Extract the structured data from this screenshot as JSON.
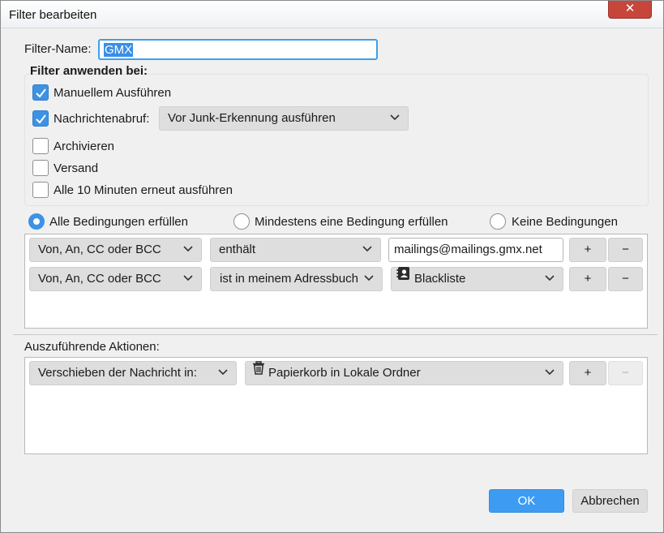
{
  "window": {
    "title": "Filter bearbeiten",
    "close_label": "✕"
  },
  "filter_name": {
    "label": "Filter-Name:",
    "value": "GMX"
  },
  "apply_section": {
    "legend": "Filter anwenden bei:",
    "options": [
      {
        "label": "Manuellem Ausführen",
        "checked": true
      },
      {
        "label": "Nachrichtenabruf:",
        "checked": true
      },
      {
        "label": "Archivieren",
        "checked": false
      },
      {
        "label": "Versand",
        "checked": false
      },
      {
        "label": "Alle 10 Minuten erneut ausführen",
        "checked": false
      }
    ],
    "fetch_timing": "Vor Junk-Erkennung ausführen"
  },
  "match_mode": {
    "options": [
      "Alle Bedingungen erfüllen",
      "Mindestens eine Bedingung erfüllen",
      "Keine Bedingungen"
    ],
    "selected": "Alle Bedingungen erfüllen"
  },
  "conditions": [
    {
      "field": "Von, An, CC oder BCC",
      "operator": "enthält",
      "value": "mailings@mailings.gmx.net"
    },
    {
      "field": "Von, An, CC oder BCC",
      "operator": "ist in meinem Adressbuch",
      "value": "Blackliste",
      "value_icon": "address-book-icon"
    }
  ],
  "actions": {
    "label": "Auszuführende Aktionen:",
    "rows": [
      {
        "action": "Verschieben der Nachricht in:",
        "target": "Papierkorb in Lokale Ordner",
        "target_icon": "trash-icon"
      }
    ]
  },
  "row_buttons": {
    "add": "+",
    "remove": "−"
  },
  "footer": {
    "ok": "OK",
    "cancel": "Abbrechen"
  },
  "colors": {
    "accent": "#3d93e3",
    "close": "#c7463b"
  }
}
